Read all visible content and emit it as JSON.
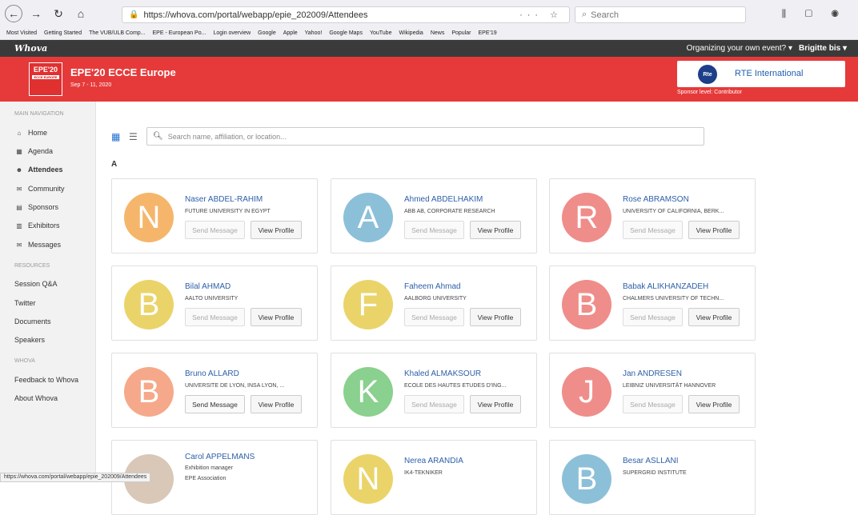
{
  "browser": {
    "url": "https://whova.com/portal/webapp/epie_202009/Attendees",
    "search_placeholder": "Search",
    "bookmarks": [
      "Most Visited",
      "Getting Started",
      "The VUB/ULB Comp...",
      "EPE - European Po...",
      "Login overview",
      "Google",
      "Apple",
      "Yahoo!",
      "Google Maps",
      "YouTube",
      "Wikipedia",
      "News",
      "Popular",
      "EPE'19"
    ],
    "status_url": "https://whova.com/portal/webapp/epie_202009/Attendees"
  },
  "topbar": {
    "logo": "Whova",
    "organize_link": "Organizing your own event? ▾",
    "user": "Brigitte bis ▾"
  },
  "banner": {
    "thumb_title": "EPE'20",
    "thumb_sub": "ECCE EUROPE",
    "title": "EPE'20 ECCE Europe",
    "dates": "Sep 7 - 11, 2020",
    "sponsor_name": "RTE International",
    "sponsor_logo_text": "Rte",
    "sponsor_level": "Sponsor level: Contributor"
  },
  "sidebar": {
    "main_nav_label": "MAIN NAVIGATION",
    "items": [
      {
        "label": "Home",
        "icon": "home-icon"
      },
      {
        "label": "Agenda",
        "icon": "calendar-icon"
      },
      {
        "label": "Attendees",
        "icon": "people-icon"
      },
      {
        "label": "Community",
        "icon": "chat-icon"
      },
      {
        "label": "Sponsors",
        "icon": "building-icon"
      },
      {
        "label": "Exhibitors",
        "icon": "booth-icon"
      },
      {
        "label": "Messages",
        "icon": "envelope-icon"
      }
    ],
    "resources_label": "RESOURCES",
    "resources": [
      "Session Q&A",
      "Twitter",
      "Documents",
      "Speakers"
    ],
    "whova_label": "WHOVA",
    "whova_items": [
      "Feedback to Whova",
      "About Whova"
    ]
  },
  "main": {
    "search_placeholder": "Search name, affiliation, or location...",
    "letter": "A",
    "send_label": "Send Message",
    "view_label": "View Profile"
  },
  "attendees": [
    {
      "name": "Naser ABDEL-RAHIM",
      "affiliation": "FUTURE UNIVERSITY IN EGYPT",
      "initial": "N",
      "color": "#f5b66b"
    },
    {
      "name": "Ahmed ABDELHAKIM",
      "affiliation": "ABB AB, CORPORATE RESEARCH",
      "initial": "A",
      "color": "#8cc0d8"
    },
    {
      "name": "Rose ABRAMSON",
      "affiliation": "UNIVERSITY OF CALIFORNIA, BERK...",
      "initial": "R",
      "color": "#ef8d8a"
    },
    {
      "name": "Bilal AHMAD",
      "affiliation": "AALTO UNIVERSITY",
      "initial": "B",
      "color": "#ead46a"
    },
    {
      "name": "Faheem Ahmad",
      "affiliation": "AALBORG UNIVERSITY",
      "initial": "F",
      "color": "#ead46a"
    },
    {
      "name": "Babak ALIKHANZADEH",
      "affiliation": "CHALMERS UNIVERSITY OF TECHN...",
      "initial": "B",
      "color": "#ef8d8a"
    },
    {
      "name": "Bruno ALLARD",
      "affiliation": "UNIVERSITE DE LYON, INSA LYON, ...",
      "initial": "B",
      "color": "#f5a98a"
    },
    {
      "name": "Khaled ALMAKSOUR",
      "affiliation": "ECOLE DES HAUTES ETUDES D'ING...",
      "initial": "K",
      "color": "#8ad08e"
    },
    {
      "name": "Jan ANDRESEN",
      "affiliation": "LEIBNIZ UNIVERSITÄT HANNOVER",
      "initial": "J",
      "color": "#ef8d8a"
    },
    {
      "name": "Carol APPELMANS",
      "affiliation": "Exhibition manager",
      "affiliation2": "EPE Association",
      "initial": "",
      "color": "#d9c7b8"
    },
    {
      "name": "Nerea ARANDIA",
      "affiliation": "IK4-TEKNIKER",
      "initial": "N",
      "color": "#ead46a"
    },
    {
      "name": "Besar ASLLANI",
      "affiliation": "SUPERGRID INSTITUTE",
      "initial": "B",
      "color": "#8cc0d8"
    }
  ]
}
